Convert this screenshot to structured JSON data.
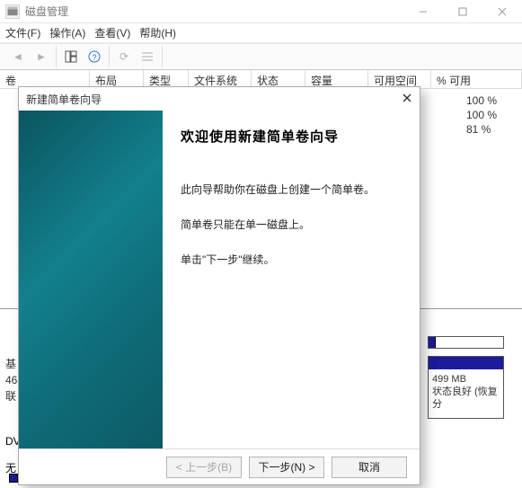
{
  "window": {
    "app_title": "磁盘管理",
    "controls": {
      "min": "minimize",
      "max": "maximize",
      "close": "close"
    }
  },
  "menu": {
    "file": "文件(F)",
    "action": "操作(A)",
    "view": "查看(V)",
    "help": "帮助(H)"
  },
  "columns": {
    "volume": "卷",
    "layout": "布局",
    "type": "类型",
    "filesystem": "文件系统",
    "status": "状态",
    "capacity": "容量",
    "free": "可用空间",
    "pct_free": "% 可用"
  },
  "rows_pct": [
    "100 %",
    "100 %",
    "81 %"
  ],
  "partition": {
    "size": "499 MB",
    "status": "状态良好 (恢复分"
  },
  "left_block": {
    "l1": "基",
    "l2": "46",
    "l3": "联"
  },
  "left_dv": "DV",
  "left_none": "无",
  "wizard": {
    "title": "新建简单卷向导",
    "heading": "欢迎使用新建简单卷向导",
    "p1": "此向导帮助你在磁盘上创建一个简单卷。",
    "p2": "简单卷只能在单一磁盘上。",
    "p3": "单击\"下一步\"继续。",
    "back": "< 上一步(B)",
    "next": "下一步(N) >",
    "cancel": "取消"
  }
}
